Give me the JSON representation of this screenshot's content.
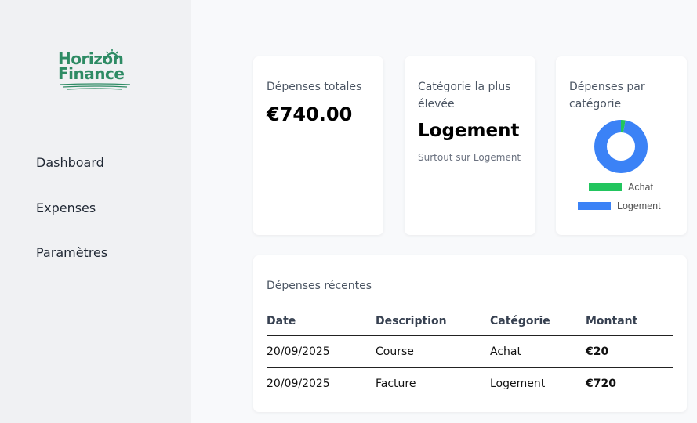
{
  "brand": {
    "line1": "Horizon",
    "line2": "Finance",
    "color": "#2e8b64"
  },
  "nav": {
    "items": [
      {
        "label": "Dashboard"
      },
      {
        "label": "Expenses"
      },
      {
        "label": "Paramètres"
      }
    ]
  },
  "cards": {
    "total": {
      "label": "Dépenses totales",
      "value": "€740.00"
    },
    "top_category": {
      "label": "Catégorie la plus élevée",
      "value": "Logement",
      "note": "Surtout sur Logement"
    },
    "by_category": {
      "label": "Dépenses par catégorie"
    }
  },
  "chart_data": {
    "type": "pie",
    "categories": [
      "Achat",
      "Logement"
    ],
    "values": [
      20,
      720
    ],
    "colors": [
      "#22c55e",
      "#3b82f6"
    ],
    "donut": true,
    "legend_position": "bottom"
  },
  "recent": {
    "title": "Dépenses récentes",
    "columns": [
      "Date",
      "Description",
      "Catégorie",
      "Montant"
    ],
    "rows": [
      [
        "20/09/2025",
        "Course",
        "Achat",
        "€20"
      ],
      [
        "20/09/2025",
        "Facture",
        "Logement",
        "€720"
      ]
    ]
  }
}
